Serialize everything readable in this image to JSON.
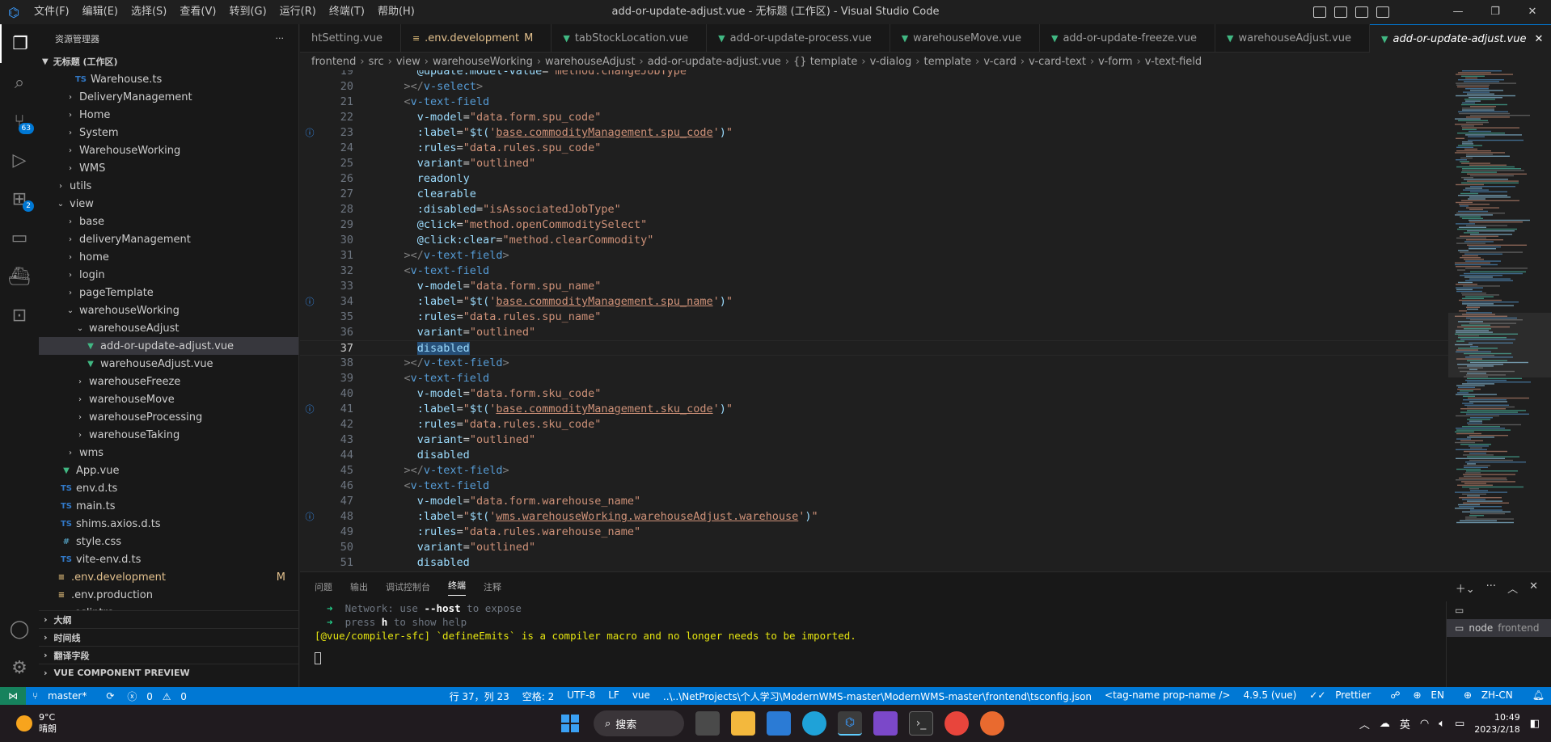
{
  "titlebar": {
    "menu": [
      "文件(F)",
      "编辑(E)",
      "选择(S)",
      "查看(V)",
      "转到(G)",
      "运行(R)",
      "终端(T)",
      "帮助(H)"
    ],
    "title": "add-or-update-adjust.vue - 无标题 (工作区) - Visual Studio Code"
  },
  "activity": {
    "source_control_badge": "63",
    "extensions_badge": "2"
  },
  "sidebar": {
    "title": "资源管理器",
    "workspace": "无标题 (工作区)",
    "tree": [
      {
        "label": "Warehouse.ts",
        "indent": 2,
        "type": "ts"
      },
      {
        "label": "DeliveryManagement",
        "indent": 1,
        "type": "folder",
        "open": false
      },
      {
        "label": "Home",
        "indent": 1,
        "type": "folder",
        "open": false
      },
      {
        "label": "System",
        "indent": 1,
        "type": "folder",
        "open": false
      },
      {
        "label": "WarehouseWorking",
        "indent": 1,
        "type": "folder",
        "open": false
      },
      {
        "label": "WMS",
        "indent": 1,
        "type": "folder",
        "open": false
      },
      {
        "label": "utils",
        "indent": 0,
        "type": "folder",
        "open": false
      },
      {
        "label": "view",
        "indent": 0,
        "type": "folder",
        "open": true
      },
      {
        "label": "base",
        "indent": 1,
        "type": "folder",
        "open": false
      },
      {
        "label": "deliveryManagement",
        "indent": 1,
        "type": "folder",
        "open": false
      },
      {
        "label": "home",
        "indent": 1,
        "type": "folder",
        "open": false
      },
      {
        "label": "login",
        "indent": 1,
        "type": "folder",
        "open": false
      },
      {
        "label": "pageTemplate",
        "indent": 1,
        "type": "folder",
        "open": false
      },
      {
        "label": "warehouseWorking",
        "indent": 1,
        "type": "folder",
        "open": true
      },
      {
        "label": "warehouseAdjust",
        "indent": 2,
        "type": "folder",
        "open": true
      },
      {
        "label": "add-or-update-adjust.vue",
        "indent": 3,
        "type": "vue",
        "selected": true
      },
      {
        "label": "warehouseAdjust.vue",
        "indent": 3,
        "type": "vue"
      },
      {
        "label": "warehouseFreeze",
        "indent": 2,
        "type": "folder",
        "open": false
      },
      {
        "label": "warehouseMove",
        "indent": 2,
        "type": "folder",
        "open": false
      },
      {
        "label": "warehouseProcessing",
        "indent": 2,
        "type": "folder",
        "open": false
      },
      {
        "label": "warehouseTaking",
        "indent": 2,
        "type": "folder",
        "open": false
      },
      {
        "label": "wms",
        "indent": 1,
        "type": "folder",
        "open": false
      },
      {
        "label": "App.vue",
        "indent": 0.5,
        "type": "vue"
      },
      {
        "label": "env.d.ts",
        "indent": 0.5,
        "type": "ts"
      },
      {
        "label": "main.ts",
        "indent": 0.5,
        "type": "ts"
      },
      {
        "label": "shims.axios.d.ts",
        "indent": 0.5,
        "type": "ts"
      },
      {
        "label": "style.css",
        "indent": 0.5,
        "type": "css"
      },
      {
        "label": "vite-env.d.ts",
        "indent": 0.5,
        "type": "ts"
      },
      {
        "label": ".env.development",
        "indent": 0,
        "type": "env",
        "modified": "M"
      },
      {
        "label": ".env.production",
        "indent": 0,
        "type": "env"
      },
      {
        "label": ".eslintrc",
        "indent": 0,
        "type": "env"
      }
    ],
    "sections": [
      "大纲",
      "时间线",
      "翻译字段",
      "VUE COMPONENT PREVIEW"
    ]
  },
  "tabs": [
    {
      "label": "htSetting.vue",
      "icon": "",
      "active": false
    },
    {
      "label": ".env.development",
      "icon": "≡",
      "active": false,
      "flag": "M"
    },
    {
      "label": "tabStockLocation.vue",
      "icon": "▼",
      "active": false
    },
    {
      "label": "add-or-update-process.vue",
      "icon": "▼",
      "active": false
    },
    {
      "label": "warehouseMove.vue",
      "icon": "▼",
      "active": false
    },
    {
      "label": "add-or-update-freeze.vue",
      "icon": "▼",
      "active": false
    },
    {
      "label": "warehouseAdjust.vue",
      "icon": "▼",
      "active": false
    },
    {
      "label": "add-or-update-adjust.vue",
      "icon": "▼",
      "active": true
    }
  ],
  "breadcrumb": [
    "frontend",
    "src",
    "view",
    "warehouseWorking",
    "warehouseAdjust",
    "add-or-update-adjust.vue",
    "{} template",
    "v-dialog",
    "template",
    "v-card",
    "v-card-text",
    "v-form",
    "v-text-field"
  ],
  "editor": {
    "lines": [
      {
        "n": "19",
        "t": "      @update:model-value=\"method.changeJobType\"",
        "k": "partial"
      },
      {
        "n": "20",
        "t": "    ></v-select>",
        "k": "close"
      },
      {
        "n": "21",
        "t": "    <v-text-field",
        "k": "open"
      },
      {
        "n": "22",
        "t": "      v-model=\"data.form.spu_code\"",
        "k": "attr"
      },
      {
        "n": "23",
        "t": "      :label=\"$t('base.commodityManagement.spu_code')\"",
        "k": "label",
        "info": true
      },
      {
        "n": "24",
        "t": "      :rules=\"data.rules.spu_code\"",
        "k": "attr"
      },
      {
        "n": "25",
        "t": "      variant=\"outlined\"",
        "k": "attr"
      },
      {
        "n": "26",
        "t": "      readonly",
        "k": "bare"
      },
      {
        "n": "27",
        "t": "      clearable",
        "k": "bare"
      },
      {
        "n": "28",
        "t": "      :disabled=\"isAssociatedJobType\"",
        "k": "attr"
      },
      {
        "n": "29",
        "t": "      @click=\"method.openCommoditySelect\"",
        "k": "attr"
      },
      {
        "n": "30",
        "t": "      @click:clear=\"method.clearCommodity\"",
        "k": "attr"
      },
      {
        "n": "31",
        "t": "    ></v-text-field>",
        "k": "close"
      },
      {
        "n": "32",
        "t": "    <v-text-field",
        "k": "open"
      },
      {
        "n": "33",
        "t": "      v-model=\"data.form.spu_name\"",
        "k": "attr"
      },
      {
        "n": "34",
        "t": "      :label=\"$t('base.commodityManagement.spu_name')\"",
        "k": "label",
        "info": true
      },
      {
        "n": "35",
        "t": "      :rules=\"data.rules.spu_name\"",
        "k": "attr"
      },
      {
        "n": "36",
        "t": "      variant=\"outlined\"",
        "k": "attr"
      },
      {
        "n": "37",
        "t": "      disabled",
        "k": "bare",
        "current": true
      },
      {
        "n": "38",
        "t": "    ></v-text-field>",
        "k": "close"
      },
      {
        "n": "39",
        "t": "    <v-text-field",
        "k": "open"
      },
      {
        "n": "40",
        "t": "      v-model=\"data.form.sku_code\"",
        "k": "attr"
      },
      {
        "n": "41",
        "t": "      :label=\"$t('base.commodityManagement.sku_code')\"",
        "k": "label",
        "info": true
      },
      {
        "n": "42",
        "t": "      :rules=\"data.rules.sku_code\"",
        "k": "attr"
      },
      {
        "n": "43",
        "t": "      variant=\"outlined\"",
        "k": "attr"
      },
      {
        "n": "44",
        "t": "      disabled",
        "k": "bare"
      },
      {
        "n": "45",
        "t": "    ></v-text-field>",
        "k": "close"
      },
      {
        "n": "46",
        "t": "    <v-text-field",
        "k": "open"
      },
      {
        "n": "47",
        "t": "      v-model=\"data.form.warehouse_name\"",
        "k": "attr"
      },
      {
        "n": "48",
        "t": "      :label=\"$t('wms.warehouseWorking.warehouseAdjust.warehouse')\"",
        "k": "label",
        "info": true
      },
      {
        "n": "49",
        "t": "      :rules=\"data.rules.warehouse_name\"",
        "k": "attr"
      },
      {
        "n": "50",
        "t": "      variant=\"outlined\"",
        "k": "attr"
      },
      {
        "n": "51",
        "t": "      disabled",
        "k": "bare"
      }
    ]
  },
  "panel": {
    "tabs": [
      "问题",
      "输出",
      "调试控制台",
      "终端",
      "注释"
    ],
    "active_tab": "终端",
    "terminal_lines": [
      {
        "prefix": "  ➜  ",
        "label": "Network",
        "rest": ": use ",
        "bold": "--host",
        "tail": " to expose"
      },
      {
        "prefix": "  ➜  ",
        "label": "press ",
        "rest": "",
        "bold": "h",
        "tail": " to show help"
      }
    ],
    "warning": "[@vue/compiler-sfc] `defineEmits` is a compiler macro and no longer needs to be imported.",
    "terminal_instance": {
      "name": "node",
      "cwd": "frontend"
    }
  },
  "statusbar": {
    "branch": "master*",
    "errors": "0",
    "warnings": "0",
    "position": "行 37，列 23",
    "spaces": "空格: 2",
    "encoding": "UTF-8",
    "eol": "LF",
    "language": "vue",
    "tsconfig": "..\\..\\NetProjects\\个人学习\\ModernWMS-master\\ModernWMS-master\\frontend\\tsconfig.json",
    "tag_style": "<tag-name prop-name />",
    "ts_version": "4.9.5 (vue)",
    "prettier": "Prettier",
    "lang1": "EN",
    "lang2": "ZH-CN"
  },
  "taskbar": {
    "temp": "9°C",
    "weather": "晴朗",
    "search": "搜索",
    "ime": "英",
    "time": "10:49",
    "date": "2023/2/18"
  },
  "colors": {
    "accent": "#0078d4",
    "vue": "#41b883",
    "ts": "#3178c6",
    "modified": "#e2c08d"
  }
}
